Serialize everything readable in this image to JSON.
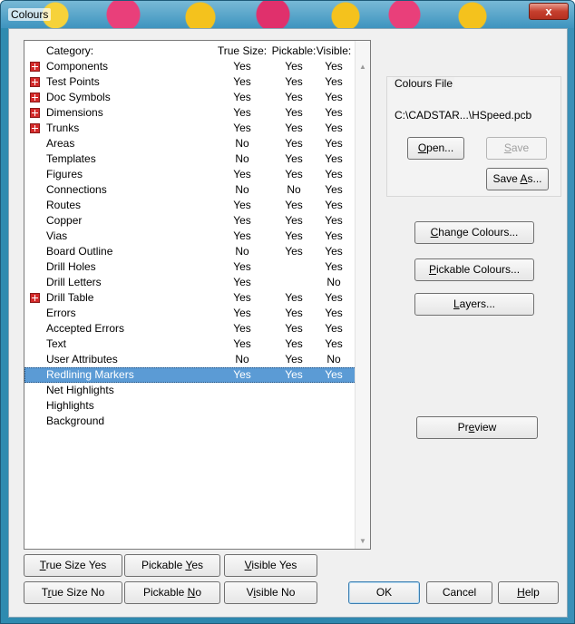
{
  "window": {
    "title": "Colours",
    "close_glyph": "x"
  },
  "list": {
    "headers": {
      "category": "Category:",
      "true_size": "True Size:",
      "pickable": "Pickable:",
      "visible": "Visible:"
    },
    "rows": [
      {
        "name": "Components",
        "expandable": true,
        "true_size": "Yes",
        "pickable": "Yes",
        "visible": "Yes"
      },
      {
        "name": "Test Points",
        "expandable": true,
        "true_size": "Yes",
        "pickable": "Yes",
        "visible": "Yes"
      },
      {
        "name": "Doc Symbols",
        "expandable": true,
        "true_size": "Yes",
        "pickable": "Yes",
        "visible": "Yes"
      },
      {
        "name": "Dimensions",
        "expandable": true,
        "true_size": "Yes",
        "pickable": "Yes",
        "visible": "Yes"
      },
      {
        "name": "Trunks",
        "expandable": true,
        "true_size": "Yes",
        "pickable": "Yes",
        "visible": "Yes"
      },
      {
        "name": "Areas",
        "expandable": false,
        "true_size": "No",
        "pickable": "Yes",
        "visible": "Yes"
      },
      {
        "name": "Templates",
        "expandable": false,
        "true_size": "No",
        "pickable": "Yes",
        "visible": "Yes"
      },
      {
        "name": "Figures",
        "expandable": false,
        "true_size": "Yes",
        "pickable": "Yes",
        "visible": "Yes"
      },
      {
        "name": "Connections",
        "expandable": false,
        "true_size": "No",
        "pickable": "No",
        "visible": "Yes"
      },
      {
        "name": "Routes",
        "expandable": false,
        "true_size": "Yes",
        "pickable": "Yes",
        "visible": "Yes"
      },
      {
        "name": "Copper",
        "expandable": false,
        "true_size": "Yes",
        "pickable": "Yes",
        "visible": "Yes"
      },
      {
        "name": "Vias",
        "expandable": false,
        "true_size": "Yes",
        "pickable": "Yes",
        "visible": "Yes"
      },
      {
        "name": "Board Outline",
        "expandable": false,
        "true_size": "No",
        "pickable": "Yes",
        "visible": "Yes"
      },
      {
        "name": "Drill Holes",
        "expandable": false,
        "true_size": "Yes",
        "pickable": "",
        "visible": "Yes"
      },
      {
        "name": "Drill Letters",
        "expandable": false,
        "true_size": "Yes",
        "pickable": "",
        "visible": "No"
      },
      {
        "name": "Drill Table",
        "expandable": true,
        "true_size": "Yes",
        "pickable": "Yes",
        "visible": "Yes"
      },
      {
        "name": "Errors",
        "expandable": false,
        "true_size": "Yes",
        "pickable": "Yes",
        "visible": "Yes"
      },
      {
        "name": "Accepted Errors",
        "expandable": false,
        "true_size": "Yes",
        "pickable": "Yes",
        "visible": "Yes"
      },
      {
        "name": "Text",
        "expandable": false,
        "true_size": "Yes",
        "pickable": "Yes",
        "visible": "Yes"
      },
      {
        "name": "User Attributes",
        "expandable": false,
        "true_size": "No",
        "pickable": "Yes",
        "visible": "No"
      },
      {
        "name": "Redlining Markers",
        "expandable": false,
        "true_size": "Yes",
        "pickable": "Yes",
        "visible": "Yes",
        "selected": true
      },
      {
        "name": "Net Highlights",
        "expandable": false,
        "true_size": "",
        "pickable": "",
        "visible": ""
      },
      {
        "name": "Highlights",
        "expandable": false,
        "true_size": "",
        "pickable": "",
        "visible": ""
      },
      {
        "name": "Background",
        "expandable": false,
        "true_size": "",
        "pickable": "",
        "visible": ""
      }
    ],
    "scroll_up_glyph": "▲",
    "scroll_down_glyph": "▼"
  },
  "colours_file": {
    "legend": "Colours File",
    "path": "C:\\CADSTAR...\\HSpeed.pcb",
    "open": {
      "pre": "",
      "key": "O",
      "post": "pen..."
    },
    "save": {
      "pre": "",
      "key": "S",
      "post": "ave"
    },
    "save_as": {
      "pre": "Save ",
      "key": "A",
      "post": "s..."
    }
  },
  "actions": {
    "change_colours": {
      "pre": "",
      "key": "C",
      "post": "hange Colours..."
    },
    "pickable_colours": {
      "pre": "",
      "key": "P",
      "post": "ickable Colours..."
    },
    "layers": {
      "pre": "",
      "key": "L",
      "post": "ayers..."
    },
    "preview": {
      "pre": "Pr",
      "key": "e",
      "post": "view"
    }
  },
  "bottom": {
    "true_size_yes": {
      "pre": "",
      "key": "T",
      "post": "rue Size Yes"
    },
    "pickable_yes": {
      "pre": "Pickable ",
      "key": "Y",
      "post": "es"
    },
    "visible_yes": {
      "pre": "",
      "key": "V",
      "post": "isible Yes"
    },
    "true_size_no": {
      "pre": "T",
      "key": "r",
      "post": "ue Size No"
    },
    "pickable_no": {
      "pre": "Pickable ",
      "key": "N",
      "post": "o"
    },
    "visible_no": {
      "pre": "V",
      "key": "i",
      "post": "sible No"
    },
    "ok": "OK",
    "cancel": "Cancel",
    "help": {
      "pre": "",
      "key": "H",
      "post": "elp"
    }
  }
}
